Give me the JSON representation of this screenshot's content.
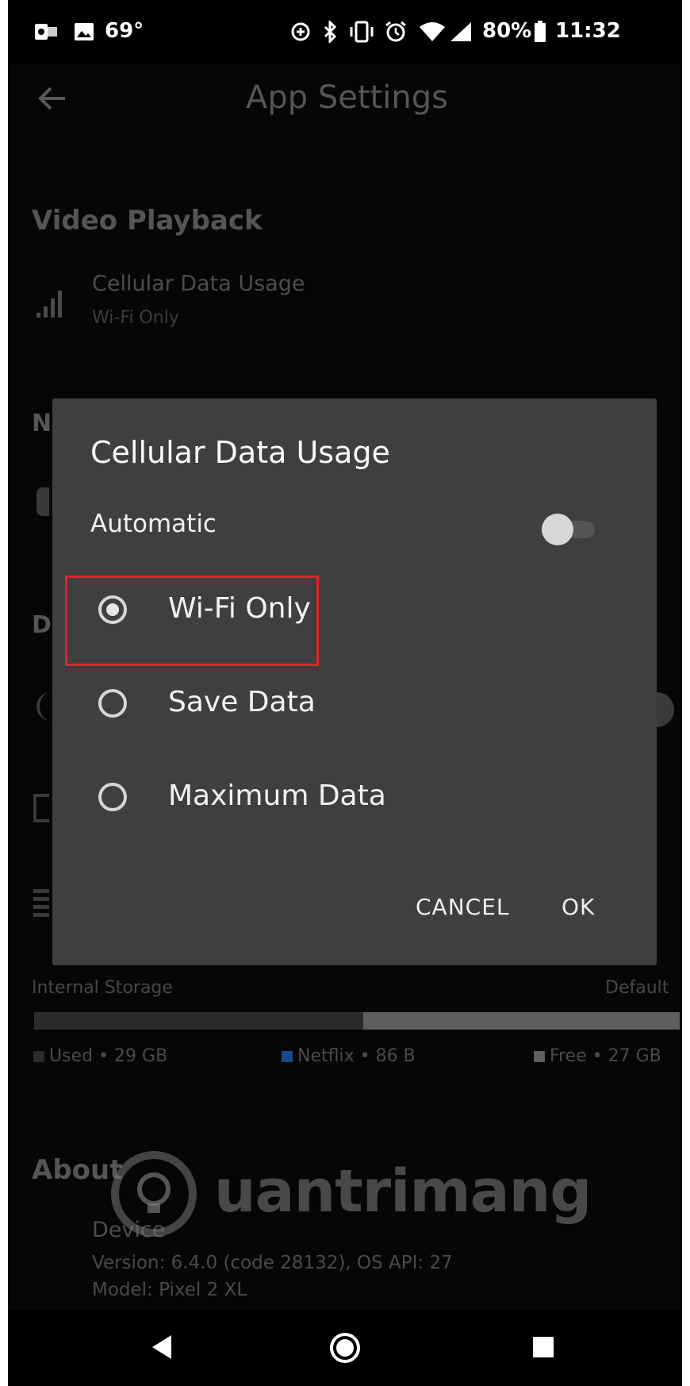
{
  "status_bar": {
    "temperature": "69°",
    "battery": "80%",
    "time": "11:32"
  },
  "app_bar": {
    "title": "App Settings"
  },
  "video_playback": {
    "heading": "Video Playback",
    "cellular_title": "Cellular Data Usage",
    "cellular_value": "Wi-Fi Only"
  },
  "storage": {
    "label": "Internal Storage",
    "default_label": "Default",
    "used": "Used • 29 GB",
    "netflix": "Netflix • 86 B",
    "free": "Free • 27 GB",
    "used_fraction": 0.51,
    "colors": {
      "used": "#2b2b2b",
      "netflix": "#1565c0",
      "free": "#5e5e5e"
    }
  },
  "about": {
    "heading": "About",
    "device_title": "Device",
    "version": "Version: 6.4.0 (code 28132), OS API: 27",
    "model": "Model: Pixel 2 XL"
  },
  "dialog": {
    "title": "Cellular Data Usage",
    "automatic_label": "Automatic",
    "automatic_on": false,
    "options": [
      {
        "label": "Wi-Fi Only",
        "selected": true
      },
      {
        "label": "Save Data",
        "selected": false
      },
      {
        "label": "Maximum Data",
        "selected": false
      }
    ],
    "cancel_label": "CANCEL",
    "ok_label": "OK",
    "highlight_color": "#e0242b"
  },
  "watermark": {
    "text": "uantrimang"
  }
}
